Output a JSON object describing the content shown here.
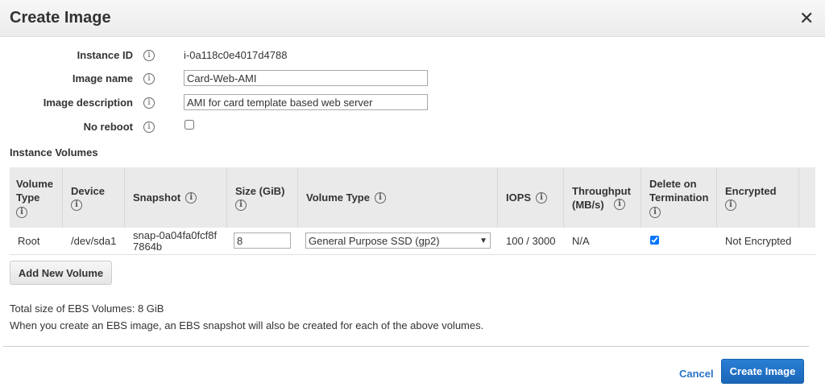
{
  "dialog": {
    "title": "Create Image",
    "close": "✕"
  },
  "form": {
    "instance_id_label": "Instance ID",
    "instance_id": "i-0a118c0e4017d4788",
    "image_name_label": "Image name",
    "image_name": "Card-Web-AMI",
    "image_description_label": "Image description",
    "image_description": "AMI for card template based web server",
    "no_reboot_label": "No reboot",
    "no_reboot": false
  },
  "volumes": {
    "section_title": "Instance Volumes",
    "columns": [
      "Volume Type",
      "Device",
      "Snapshot",
      "Size (GiB)",
      "Volume Type",
      "IOPS",
      "Throughput (MB/s)",
      "Delete on Termination",
      "Encrypted"
    ],
    "rows": [
      {
        "volume_type": "Root",
        "device": "/dev/sda1",
        "snapshot": "snap-0a04fa0fcf8f7864b",
        "size": "8",
        "type": "General Purpose SSD (gp2)",
        "iops": "100 / 3000",
        "throughput": "N/A",
        "delete_on_termination": true,
        "encrypted": "Not Encrypted"
      }
    ],
    "add_button": "Add New Volume"
  },
  "footer": {
    "total_size": "Total size of EBS Volumes: 8 GiB",
    "note": "When you create an EBS image, an EBS snapshot will also be created for each of the above volumes.",
    "cancel": "Cancel",
    "create": "Create Image"
  },
  "info_glyph": "i"
}
